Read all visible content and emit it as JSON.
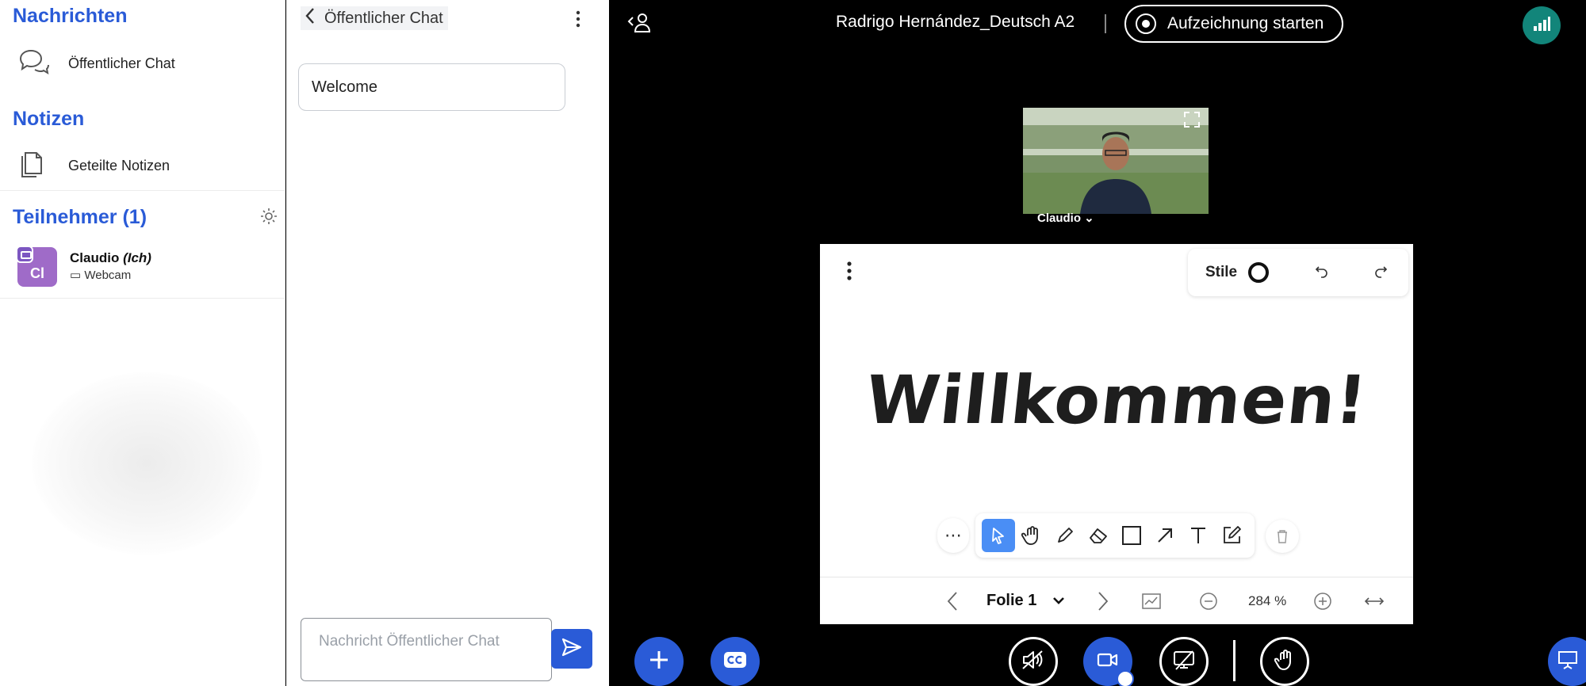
{
  "sidebar": {
    "messages_title": "Nachrichten",
    "public_chat_label": "Öffentlicher Chat",
    "notes_title": "Notizen",
    "shared_notes_label": "Geteilte Notizen",
    "participants_title": "Teilnehmer (1)",
    "user": {
      "initials": "Cl",
      "name": "Claudio",
      "self_tag": "(Ich)",
      "status": "Webcam",
      "avatar_color": "#9f6bc8"
    }
  },
  "chat": {
    "header_title": "Öffentlicher Chat",
    "welcome_message": "Welcome",
    "input_placeholder": "Nachricht Öffentlicher Chat"
  },
  "topbar": {
    "meeting_title": "Radrigo Hernández_Deutsch A2",
    "record_label": "Aufzeichnung starten",
    "connection_color": "#12857a"
  },
  "webcam": {
    "user_label": "Claudio ⌄"
  },
  "whiteboard": {
    "style_label": "Stile",
    "slide_text": "Willkommen!",
    "slide_selector": "Folie 1",
    "zoom": "284 %",
    "tools": [
      "select-icon",
      "hand-icon",
      "pencil-icon",
      "eraser-icon",
      "rectangle-icon",
      "arrow-icon",
      "text-icon",
      "note-icon"
    ],
    "active_tool": "select-icon"
  },
  "colors": {
    "accent": "#2a5bd7",
    "active_tool": "#4a8ef5",
    "background": "#000000"
  }
}
